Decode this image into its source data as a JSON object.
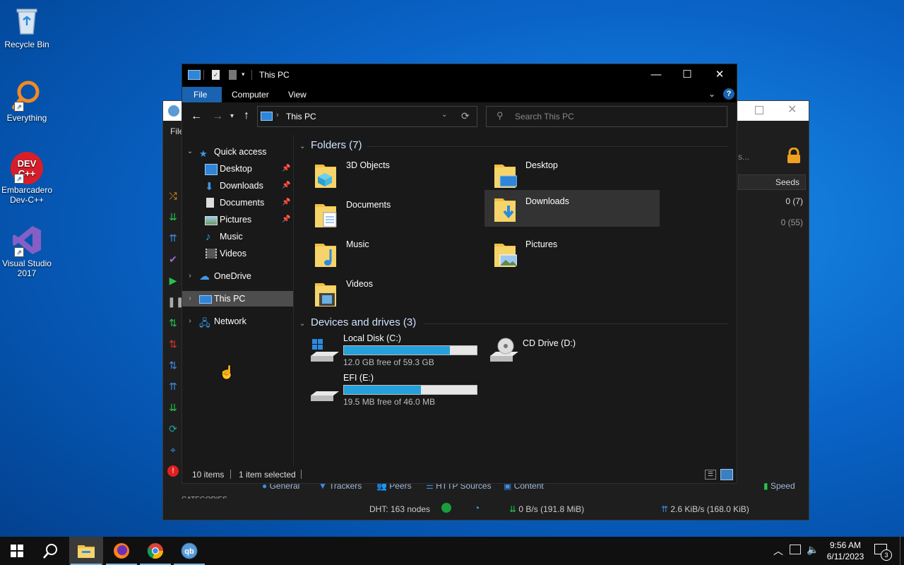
{
  "desktop": {
    "icons": [
      {
        "label": "Recycle Bin",
        "icon": "recycle-bin-icon"
      },
      {
        "label": "Everything",
        "icon": "everything-search-icon"
      },
      {
        "label": "Embarcadero Dev-C++",
        "icon": "devcpp-icon"
      },
      {
        "label": "Visual Studio 2017",
        "icon": "visual-studio-icon"
      }
    ],
    "devcpp_badge": "DEV C++"
  },
  "qbittorrent": {
    "menu_file": "File",
    "search_hint": "s...",
    "column_seeds": "Seeds",
    "row_values": [
      "0 (7)",
      "0 (55)"
    ],
    "tabs": [
      "General",
      "Trackers",
      "Peers",
      "HTTP Sources",
      "Content"
    ],
    "speed_label": "Speed",
    "status": {
      "dht": "DHT: 163 nodes",
      "download": "0 B/s (191.8 MiB)",
      "upload": "2.6 KiB/s (168.0 KiB)"
    },
    "categories_label": "CATEGORIES"
  },
  "explorer": {
    "title": "This PC",
    "ribbon_tabs": [
      "File",
      "Computer",
      "View"
    ],
    "address": "This PC",
    "search_placeholder": "Search This PC",
    "nav": {
      "quick_access": "Quick access",
      "quick_items": [
        "Desktop",
        "Downloads",
        "Documents",
        "Pictures",
        "Music",
        "Videos"
      ],
      "onedrive": "OneDrive",
      "this_pc": "This PC",
      "network": "Network"
    },
    "folders_header": "Folders (7)",
    "folders": [
      "3D Objects",
      "Desktop",
      "Documents",
      "Downloads",
      "Music",
      "Pictures",
      "Videos"
    ],
    "drives_header": "Devices and drives (3)",
    "drives": [
      {
        "name": "Local Disk (C:)",
        "info": "12.0 GB free of 59.3 GB",
        "used_fraction": 0.8
      },
      {
        "name": "CD Drive (D:)"
      },
      {
        "name": "EFI (E:)",
        "info": "19.5 MB free of 46.0 MB",
        "used_fraction": 0.58
      }
    ],
    "status": {
      "items": "10 items",
      "selected": "1 item selected"
    }
  },
  "taskbar": {
    "time": "9:56 AM",
    "date": "6/11/2023",
    "notification_count": "3"
  },
  "colors": {
    "accent": "#1a63b0",
    "drive_fill": "#26a0da",
    "window_bg": "#191919"
  }
}
